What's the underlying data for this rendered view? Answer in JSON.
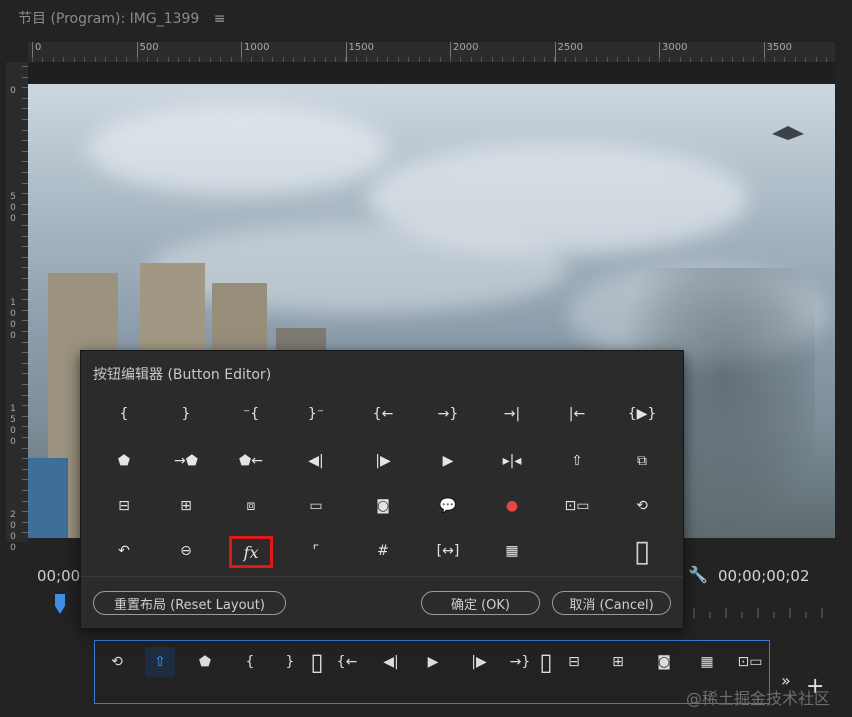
{
  "panel": {
    "title": "节目 (Program): IMG_1399",
    "menu_icon": "hamburger-menu-icon"
  },
  "ruler": {
    "top_labels": [
      "0",
      "500",
      "1000",
      "1500",
      "2000",
      "2500",
      "3000",
      "3500"
    ],
    "left_labels": [
      [
        "0"
      ],
      [
        "5",
        "0",
        "0"
      ],
      [
        "1",
        "0",
        "0",
        "0"
      ],
      [
        "1",
        "5",
        "0",
        "0"
      ],
      [
        "2",
        "0",
        "0",
        "0"
      ]
    ]
  },
  "timecode": {
    "left": "00;00",
    "right": "00;00;00;02"
  },
  "dialog": {
    "title": "按钮编辑器 (Button Editor)",
    "reset_label": "重置布局 (Reset Layout)",
    "ok_label": "确定 (OK)",
    "cancel_label": "取消 (Cancel)",
    "buttons": [
      {
        "name": "mark-in-icon",
        "glyph": "{"
      },
      {
        "name": "mark-out-icon",
        "glyph": "}"
      },
      {
        "name": "clear-in-icon",
        "glyph": "⁻{"
      },
      {
        "name": "clear-out-icon",
        "glyph": "}⁻"
      },
      {
        "name": "go-to-in-icon",
        "glyph": "{←"
      },
      {
        "name": "go-to-out-icon",
        "glyph": "→}"
      },
      {
        "name": "go-to-next-edit-icon",
        "glyph": "→|"
      },
      {
        "name": "go-to-previous-edit-icon",
        "glyph": "|←"
      },
      {
        "name": "play-in-to-out-icon",
        "glyph": "{▶}"
      },
      {
        "name": "add-marker-icon",
        "glyph": "⬟"
      },
      {
        "name": "go-to-next-marker-icon",
        "glyph": "→⬟"
      },
      {
        "name": "go-to-previous-marker-icon",
        "glyph": "⬟←"
      },
      {
        "name": "step-back-icon",
        "glyph": "◀|"
      },
      {
        "name": "step-forward-icon",
        "glyph": "|▶"
      },
      {
        "name": "play-icon",
        "glyph": "▶"
      },
      {
        "name": "play-around-icon",
        "glyph": "▸|◂"
      },
      {
        "name": "export-frame-lift-icon",
        "glyph": "⇧"
      },
      {
        "name": "extract-icon",
        "glyph": "⧉"
      },
      {
        "name": "lift-icon",
        "glyph": "⊟"
      },
      {
        "name": "insert-icon",
        "glyph": "⊞"
      },
      {
        "name": "overwrite-icon",
        "glyph": "⧈"
      },
      {
        "name": "safe-margins-icon",
        "glyph": "▭"
      },
      {
        "name": "camera-icon",
        "glyph": "◙"
      },
      {
        "name": "comment-icon",
        "glyph": "💬"
      },
      {
        "name": "record-icon",
        "glyph": "●"
      },
      {
        "name": "multi-camera-icon",
        "glyph": "⊡▭"
      },
      {
        "name": "toggle-proxy-icon",
        "glyph": "⟲"
      },
      {
        "name": "loop-icon",
        "glyph": "↶"
      },
      {
        "name": "vr-video-icon",
        "glyph": "⊖"
      },
      {
        "name": "fx-icon",
        "glyph": "fx"
      },
      {
        "name": "show-rulers-icon",
        "glyph": "⌜"
      },
      {
        "name": "show-guides-icon",
        "glyph": "#"
      },
      {
        "name": "snap-in-program-icon",
        "glyph": "[↔]"
      },
      {
        "name": "compare-view-icon",
        "glyph": "▦"
      },
      {
        "name": "spacer-icon",
        "glyph": "▯"
      }
    ]
  },
  "transport_bar": {
    "buttons": [
      {
        "name": "toggle-proxy-icon",
        "glyph": "⟲"
      },
      {
        "name": "export-frame-lift-icon",
        "glyph": "⇧"
      },
      {
        "name": "add-marker-icon",
        "glyph": "⬟"
      },
      {
        "name": "mark-in-icon",
        "glyph": "{"
      },
      {
        "name": "mark-out-icon",
        "glyph": "}"
      },
      {
        "name": "spacer-icon",
        "glyph": "▯"
      },
      {
        "name": "go-to-in-icon",
        "glyph": "{←"
      },
      {
        "name": "step-back-icon",
        "glyph": "◀|"
      },
      {
        "name": "play-icon",
        "glyph": "▶"
      },
      {
        "name": "step-forward-icon",
        "glyph": "|▶"
      },
      {
        "name": "go-to-out-icon",
        "glyph": "→}"
      },
      {
        "name": "spacer-icon",
        "glyph": "▯"
      },
      {
        "name": "lift-icon",
        "glyph": "⊟"
      },
      {
        "name": "insert-icon",
        "glyph": "⊞"
      },
      {
        "name": "camera-icon",
        "glyph": "◙"
      },
      {
        "name": "compare-view-icon",
        "glyph": "▦"
      },
      {
        "name": "multi-camera-icon",
        "glyph": "⊡▭"
      }
    ],
    "overflow_icon": "chevron-double-right-icon",
    "add_icon": "plus-icon"
  },
  "watermark": "@稀土掘金技术社区",
  "colors": {
    "background": "#232323",
    "dialog_bg": "#2b2b2b",
    "selection_red": "#e01818",
    "accent_blue": "#3b7bd6",
    "record_red": "#e84545"
  }
}
